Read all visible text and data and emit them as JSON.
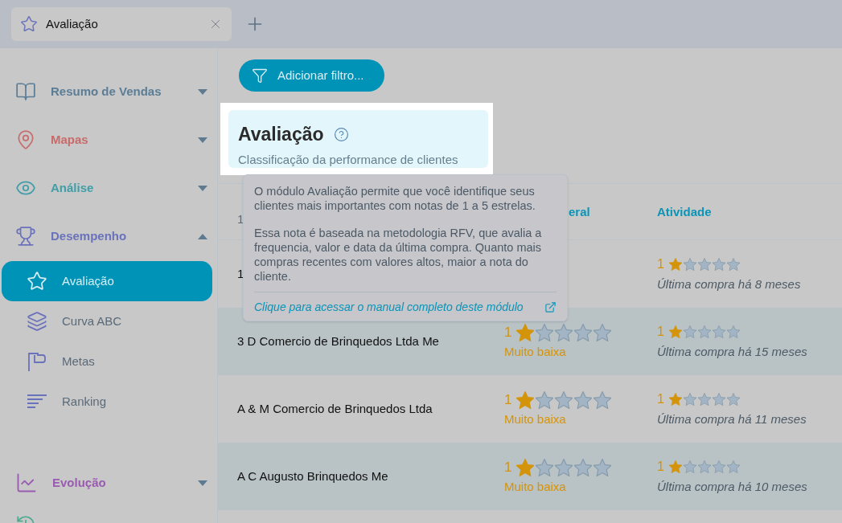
{
  "tab": {
    "title": "Avaliação"
  },
  "sidebar": {
    "sections": [
      {
        "label": "Resumo de Vendas",
        "color": "#5b7d96",
        "expanded": false
      },
      {
        "label": "Mapas",
        "color": "#c86b6b",
        "expanded": false
      },
      {
        "label": "Análise",
        "color": "#3f9ea8",
        "expanded": false
      },
      {
        "label": "Desempenho",
        "color": "#6a72bb",
        "expanded": true,
        "children": [
          {
            "label": "Avaliação",
            "selected": true
          },
          {
            "label": "Curva ABC",
            "selected": false
          },
          {
            "label": "Metas",
            "selected": false
          },
          {
            "label": "Ranking",
            "selected": false
          }
        ]
      },
      {
        "label": "Evolução",
        "color": "#9a5cb0",
        "expanded": false
      }
    ]
  },
  "filter_button": "Adicionar filtro...",
  "card": {
    "title": "Avaliação",
    "subtitle": "Classificação da performance de clientes"
  },
  "tooltip": {
    "paragraphs": [
      "O módulo Avaliação permite que você identifique seus clientes mais importantes com notas de 1 a 5 estrelas.",
      "Essa nota é baseada na metodologia RFV, que avalia a frequencia, valor e data da última compra. Quanto mais compras recentes com valores altos, maior a nota do cliente."
    ],
    "link": "Clique para acessar o manual completo deste módulo"
  },
  "table": {
    "columns": [
      {
        "sublabel": "1"
      },
      {
        "label": "eral"
      },
      {
        "label": "Atividade"
      }
    ],
    "rows": [
      {
        "name": "1",
        "geral": {},
        "atividade": {
          "score": "1",
          "stars": 1,
          "note": "Última compra há 8 meses"
        }
      },
      {
        "name": "3 D Comercio de Brinquedos Ltda Me",
        "geral": {
          "score": "1",
          "stars": 1,
          "level": "Muito baixa"
        },
        "atividade": {
          "score": "1",
          "stars": 1,
          "note": "Última compra há 15 meses"
        }
      },
      {
        "name": "A & M Comercio de Brinquedos Ltda",
        "geral": {
          "score": "1",
          "stars": 1,
          "level": "Muito baixa"
        },
        "atividade": {
          "score": "1",
          "stars": 1,
          "note": "Última compra há 11 meses"
        }
      },
      {
        "name": "A C Augusto Brinquedos Me",
        "geral": {
          "score": "1",
          "stars": 1,
          "level": "Muito baixa"
        },
        "atividade": {
          "score": "1",
          "stars": 1,
          "note": "Última compra há 10 meses"
        }
      }
    ]
  }
}
